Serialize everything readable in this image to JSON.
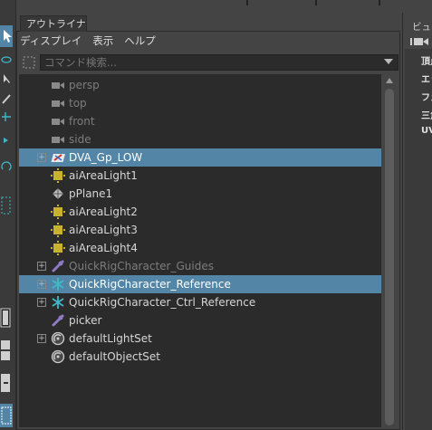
{
  "outliner": {
    "tab_title": "アウトライナ",
    "menu": [
      "ディスプレイ",
      "表示",
      "ヘルプ"
    ],
    "search_placeholder": "コマンド検索...",
    "items": [
      {
        "label": "persp",
        "icon": "camera-icon",
        "dim": true,
        "selected": false,
        "expandable": false
      },
      {
        "label": "top",
        "icon": "camera-icon",
        "dim": true,
        "selected": false,
        "expandable": false
      },
      {
        "label": "front",
        "icon": "camera-icon",
        "dim": true,
        "selected": false,
        "expandable": false
      },
      {
        "label": "side",
        "icon": "camera-icon",
        "dim": true,
        "selected": false,
        "expandable": false
      },
      {
        "label": "DVA_Gp_LOW",
        "icon": "group-mesh-icon",
        "dim": false,
        "selected": true,
        "expandable": true
      },
      {
        "label": "aiAreaLight1",
        "icon": "area-light-icon",
        "dim": false,
        "selected": false,
        "expandable": false
      },
      {
        "label": "pPlane1",
        "icon": "mesh-icon",
        "dim": false,
        "selected": false,
        "expandable": false
      },
      {
        "label": "aiAreaLight2",
        "icon": "area-light-icon",
        "dim": false,
        "selected": false,
        "expandable": false
      },
      {
        "label": "aiAreaLight3",
        "icon": "area-light-icon",
        "dim": false,
        "selected": false,
        "expandable": false
      },
      {
        "label": "aiAreaLight4",
        "icon": "area-light-icon",
        "dim": false,
        "selected": false,
        "expandable": false
      },
      {
        "label": "QuickRigCharacter_Guides",
        "icon": "guides-icon",
        "dim": true,
        "selected": false,
        "expandable": true
      },
      {
        "label": "QuickRigCharacter_Reference",
        "icon": "skeleton-icon",
        "dim": false,
        "selected": true,
        "expandable": true
      },
      {
        "label": "QuickRigCharacter_Ctrl_Reference",
        "icon": "skeleton-icon",
        "dim": false,
        "selected": false,
        "expandable": true
      },
      {
        "label": "picker",
        "icon": "guides-icon",
        "dim": false,
        "selected": false,
        "expandable": false
      },
      {
        "label": "defaultLightSet",
        "icon": "set-icon",
        "dim": false,
        "selected": false,
        "expandable": true
      },
      {
        "label": "defaultObjectSet",
        "icon": "set-icon",
        "dim": false,
        "selected": false,
        "expandable": false
      }
    ]
  },
  "right_panel": {
    "title": "ビュー",
    "lines": [
      "頂点",
      "エッ",
      "フェ",
      "三角",
      "UV"
    ]
  },
  "colors": {
    "selection": "#5285a6",
    "tree_bg": "#2b2b2b",
    "light_icon": "#c9b22e",
    "skeleton_icon": "#3fb8c8",
    "guides_icon": "#8f7ac4"
  }
}
